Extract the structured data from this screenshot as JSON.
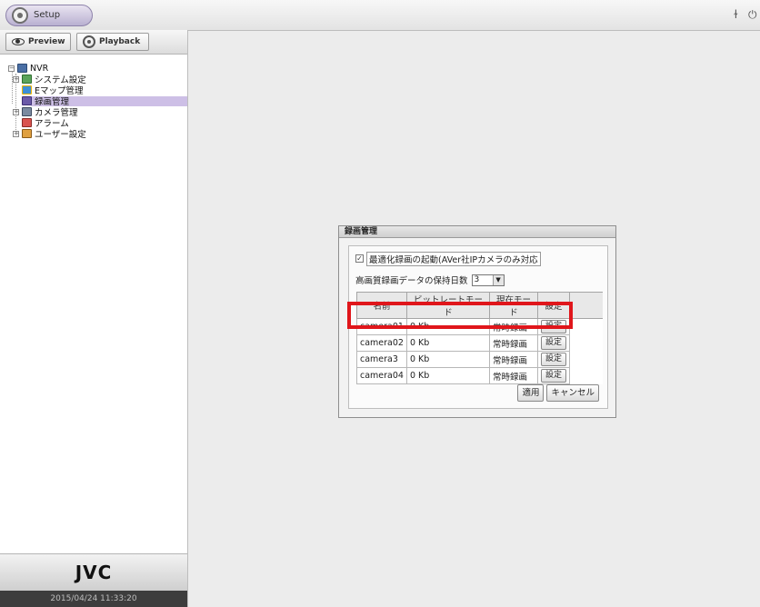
{
  "header": {
    "setup_tab": "Setup",
    "right_icons": [
      "info-icon",
      "power-icon"
    ]
  },
  "modes": {
    "preview": "Preview",
    "playback": "Playback"
  },
  "tree": {
    "root": "NVR",
    "items": [
      {
        "label": "システム設定",
        "expandable": true
      },
      {
        "label": "Eマップ管理",
        "expandable": false
      },
      {
        "label": "録画管理",
        "expandable": false,
        "selected": true
      },
      {
        "label": "カメラ管理",
        "expandable": true
      },
      {
        "label": "アラーム",
        "expandable": false
      },
      {
        "label": "ユーザー設定",
        "expandable": true
      }
    ]
  },
  "brand": "JVC",
  "clock": "2015/04/24 11:33:20",
  "dialog": {
    "title": "録画管理",
    "optimize_checkbox": {
      "checked": true,
      "label": "最適化録画の起動(AVer社IPカメラのみ対応"
    },
    "retention_label": "高画質録画データの保持日数",
    "retention_value": "3",
    "columns": [
      "名前",
      "ビットレートモード",
      "現在モード",
      "設定"
    ],
    "rows": [
      {
        "name": "camera01",
        "bitrate": "0 Kb",
        "mode": "常時録画",
        "action": "設定"
      },
      {
        "name": "camera02",
        "bitrate": "0 Kb",
        "mode": "常時録画",
        "action": "設定"
      },
      {
        "name": "camera3",
        "bitrate": "0 Kb",
        "mode": "常時録画",
        "action": "設定"
      },
      {
        "name": "camera04",
        "bitrate": "0 Kb",
        "mode": "常時録画",
        "action": "設定"
      }
    ],
    "apply_label": "適用",
    "cancel_label": "キャンセル"
  },
  "colors": {
    "highlight": "#e0161b",
    "selected_tree_row": "#cdbfe6"
  }
}
